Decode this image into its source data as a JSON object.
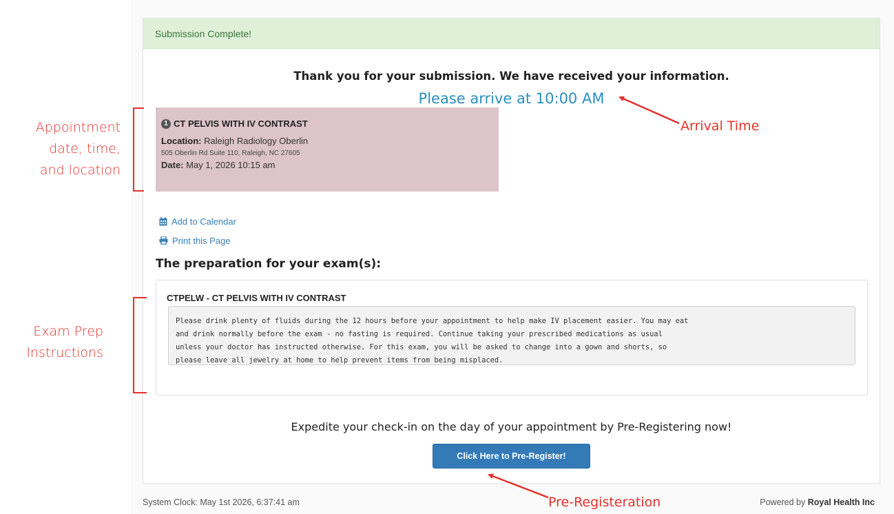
{
  "panel": {
    "heading": "Submission Complete!",
    "thanks": "Thank you for your submission. We have received your information.",
    "arrive": "Please arrive at 10:00 AM"
  },
  "appointment": {
    "badge": "1",
    "title": "CT PELVIS WITH IV CONTRAST",
    "location_label": "Location:",
    "location": "Raleigh Radiology Oberlin",
    "address": "505 Oberlin Rd Suite 110, Raleigh, NC 27605",
    "date_label": "Date:",
    "date": "May 1, 2026 10:15 am"
  },
  "links": {
    "calendar": "Add to Calendar",
    "print": "Print this Page"
  },
  "prep": {
    "heading": "The preparation for your exam(s):",
    "exam_title": "CTPELW - CT PELVIS WITH IV CONTRAST",
    "instructions": "Please drink plenty of fluids during the 12 hours before your appointment to help make IV placement easier. You may eat\nand drink normally before the exam - no fasting is required. Continue taking your prescribed medications as usual\nunless your doctor has instructed otherwise. For this exam, you will be asked to change into a gown and shorts, so\nplease leave all jewelry at home to help prevent items from being misplaced."
  },
  "prereg": {
    "text": "Expedite your check-in on the day of your appointment by Pre-Registering now!",
    "button": "Click Here to Pre-Register!"
  },
  "footer": {
    "clock": "System Clock: May 1st 2026, 6:37:41 am",
    "powered_prefix": "Powered by",
    "powered_brand": "Royal Health Inc"
  },
  "annotations": {
    "appointment": [
      "Appointment",
      "date, time,",
      "and location"
    ],
    "exam_prep": [
      "Exam Prep",
      "Instructions"
    ],
    "arrival": "Arrival Time",
    "prereg": "Pre-Registeration"
  },
  "colors": {
    "annotation": "#e4302a",
    "success_bg": "#dff0d8",
    "arrive_text": "#2a8fbd",
    "appt_bg": "#dcc4ca",
    "button": "#337ab7"
  }
}
